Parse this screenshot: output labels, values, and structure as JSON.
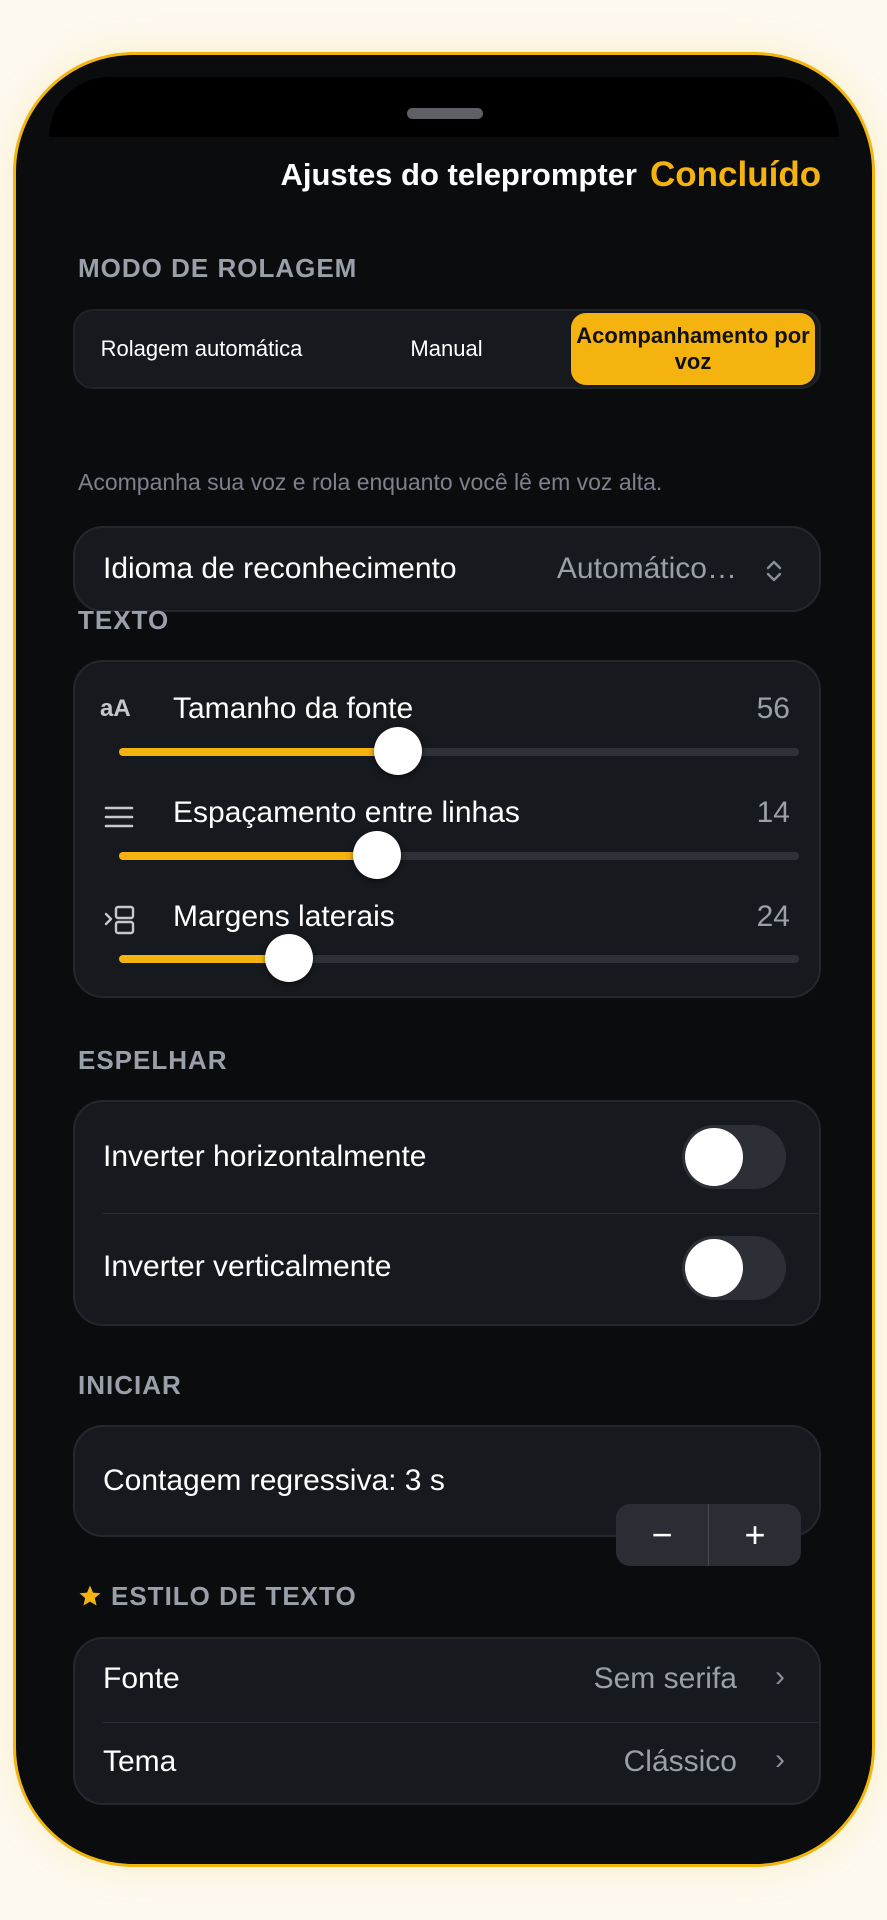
{
  "header": {
    "title": "Ajustes do teleprompter",
    "done_label": "Concluído"
  },
  "scroll_mode": {
    "section_label": "MODO DE ROLAGEM",
    "options": [
      "Rolagem automática",
      "Manual",
      "Acompanhamento por voz"
    ],
    "selected": "Acompanhamento por voz",
    "hint": "Acompanha sua voz e rola enquanto você lê em voz alta.",
    "recognition_language": {
      "label": "Idioma de reconhecimento",
      "value": "Automático…",
      "icon": "chevron-up-down-icon"
    }
  },
  "text": {
    "section_label": "TEXTO",
    "sliders": [
      {
        "label": "Tamanho da fonte",
        "value": "56",
        "icon": "text-size-icon",
        "icon_text": "aA",
        "level": 0.41
      },
      {
        "label": "Espaçamento entre linhas",
        "value": "14",
        "icon": "line-spacing-icon",
        "level": 0.38
      },
      {
        "label": "Margens laterais",
        "value": "24",
        "icon": "side-margins-icon",
        "level": 0.25
      }
    ]
  },
  "mirror": {
    "section_label": "ESPELHAR",
    "toggles": [
      {
        "label": "Inverter horizontalmente",
        "on": false
      },
      {
        "label": "Inverter verticalmente",
        "on": false
      }
    ]
  },
  "start": {
    "section_label": "INICIAR",
    "countdown_label": "Contagem regressiva: 3 s",
    "minus": "−",
    "plus": "+"
  },
  "text_style": {
    "section_label": "ESTILO DE TEXTO",
    "icon": "star-icon",
    "rows": [
      {
        "label": "Fonte",
        "value": "Sem serifa"
      },
      {
        "label": "Tema",
        "value": "Clássico"
      }
    ]
  },
  "colors": {
    "accent": "#f5b30f",
    "background": "#0b0c0e",
    "card": "#16191e"
  }
}
